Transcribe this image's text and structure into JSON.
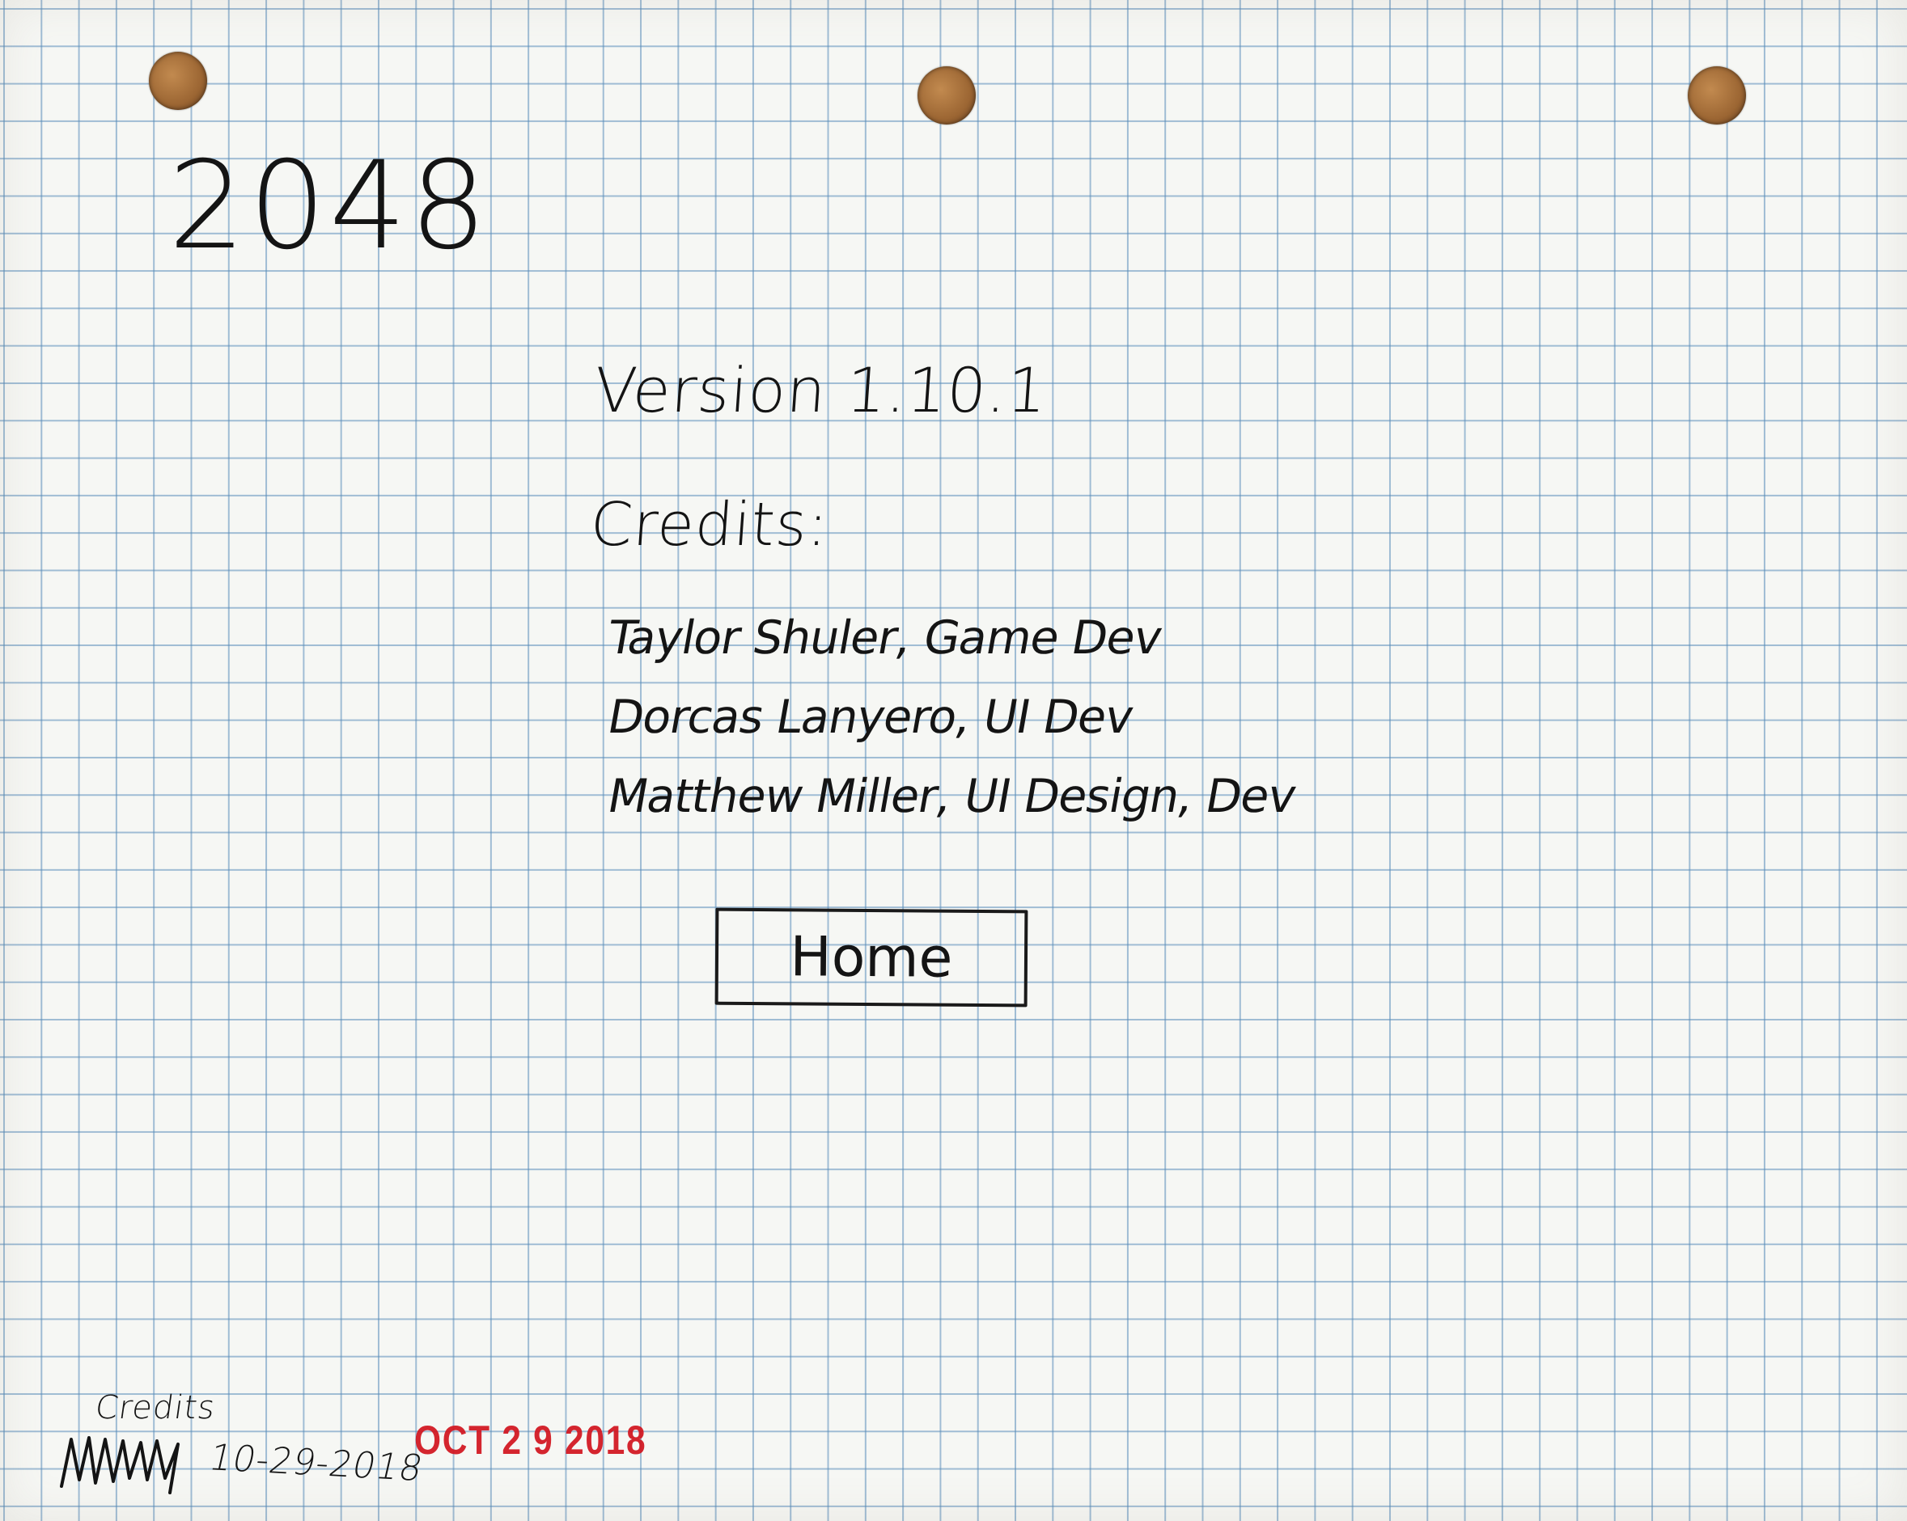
{
  "app": {
    "title": "2048"
  },
  "credits_screen": {
    "version_text": "Version 1.10.1",
    "credits_heading": "Credits:",
    "credits": [
      "Taylor Shuler, Game Dev",
      "Dorcas Lanyero, UI Dev",
      "Matthew Miller, UI Design, Dev"
    ],
    "home_button_label": "Home"
  },
  "annotation": {
    "caption": "Credits",
    "date": "10-29-2018",
    "stamp_date": "OCT 2 9 2018",
    "stamp_color": "#d2141e"
  },
  "colors": {
    "paper": "#f6f7f4",
    "grid_line": "#588cb9",
    "ink": "#141414",
    "binder_hole": "#9c6633"
  }
}
